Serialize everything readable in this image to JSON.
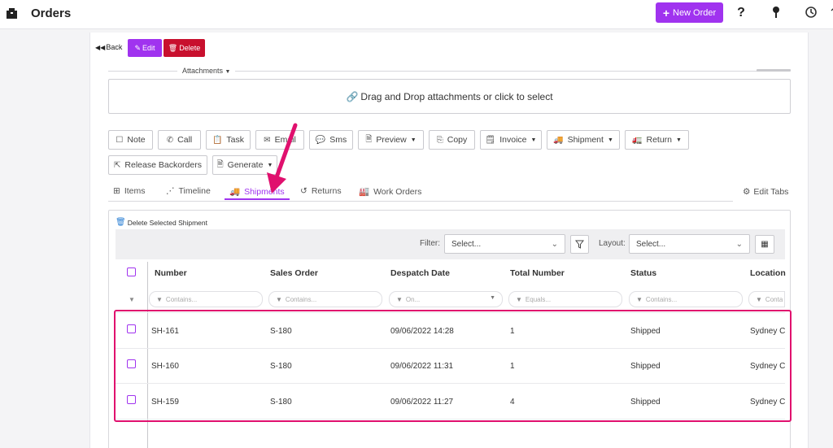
{
  "header": {
    "title": "Orders",
    "new_order_label": "New Order",
    "help_icon": "question-icon",
    "pin_icon": "pin-icon",
    "history_icon": "history-icon"
  },
  "actions": {
    "back_label": "Back",
    "edit_label": "Edit",
    "delete_label": "Delete"
  },
  "attachments": {
    "label": "Attachments",
    "dropzone_text": "Drag and Drop attachments or click to select"
  },
  "buttons_row1": [
    {
      "label": "Note",
      "icon": "note-icon"
    },
    {
      "label": "Call",
      "icon": "phone-icon"
    },
    {
      "label": "Task",
      "icon": "clipboard-icon"
    },
    {
      "label": "Email",
      "icon": "mail-icon"
    },
    {
      "label": "Sms",
      "icon": "chat-icon"
    },
    {
      "label": "Preview",
      "icon": "file-icon"
    },
    {
      "label": "Copy",
      "icon": "copy-icon"
    },
    {
      "label": "Invoice",
      "icon": "invoice-icon"
    },
    {
      "label": "Shipment",
      "icon": "truck-icon"
    },
    {
      "label": "Return",
      "icon": "return-truck-icon"
    }
  ],
  "buttons_row2": [
    {
      "label": "Release Backorders",
      "icon": "release-icon"
    },
    {
      "label": "Generate",
      "icon": "document-icon"
    }
  ],
  "tabs": [
    {
      "label": "Items",
      "icon": "sitemap-icon"
    },
    {
      "label": "Timeline",
      "icon": "timeline-icon"
    },
    {
      "label": "Shipments",
      "icon": "truck-icon"
    },
    {
      "label": "Returns",
      "icon": "undo-icon"
    },
    {
      "label": "Work Orders",
      "icon": "factory-icon"
    }
  ],
  "active_tab": "Shipments",
  "edit_tabs_label": "Edit Tabs",
  "grid": {
    "delete_selected_label": "Delete Selected Shipment",
    "filter_label": "Filter:",
    "filter_placeholder": "Select...",
    "layout_label": "Layout:",
    "layout_placeholder": "Select...",
    "columns": [
      "Number",
      "Sales Order",
      "Despatch Date",
      "Total Number",
      "Status",
      "Location"
    ],
    "filters": [
      "Contains...",
      "Contains...",
      "On...",
      "Equals...",
      "Contains...",
      "Conta"
    ],
    "rows": [
      {
        "number": "SH-161",
        "sales_order": "S-180",
        "despatch_date": "09/06/2022 14:28",
        "total": "1",
        "status": "Shipped",
        "location": "Sydney C"
      },
      {
        "number": "SH-160",
        "sales_order": "S-180",
        "despatch_date": "09/06/2022 11:31",
        "total": "1",
        "status": "Shipped",
        "location": "Sydney C"
      },
      {
        "number": "SH-159",
        "sales_order": "S-180",
        "despatch_date": "09/06/2022 11:27",
        "total": "4",
        "status": "Shipped",
        "location": "Sydney C"
      }
    ]
  },
  "colors": {
    "accent": "#a033ef",
    "danger": "#c8102e",
    "annotation": "#e0106e"
  }
}
